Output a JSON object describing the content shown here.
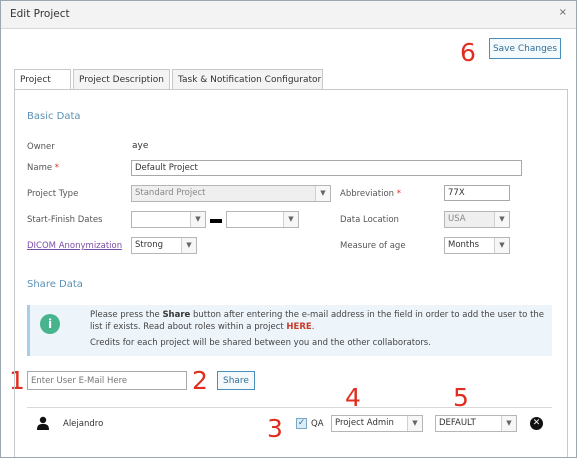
{
  "dialog": {
    "title": "Edit Project",
    "close_glyph": "×"
  },
  "toolbar": {
    "save_label": "Save Changes"
  },
  "tabs": [
    {
      "label": "Project",
      "active": true
    },
    {
      "label": "Project Description",
      "active": false
    },
    {
      "label": "Task & Notification Configurator",
      "active": false
    }
  ],
  "basic": {
    "section_title": "Basic Data",
    "owner_label": "Owner",
    "owner_value": "aye",
    "name_label": "Name",
    "required_mark": "*",
    "name_value": "Default Project",
    "project_type_label": "Project Type",
    "project_type_value": "Standard Project",
    "abbreviation_label": "Abbreviation",
    "abbreviation_value": "77X",
    "dates_label": "Start-Finish Dates",
    "start_date_value": "",
    "finish_date_value": "",
    "data_location_label": "Data Location",
    "data_location_value": "USA",
    "dicom_label": "DICOM Anonymization",
    "dicom_value": "Strong",
    "measure_label": "Measure of age",
    "measure_value": "Months"
  },
  "share": {
    "section_title": "Share Data",
    "info_line1_a": "Please press the ",
    "info_line1_b": "Share",
    "info_line1_c": " button after entering the e-mail address in the field in order to add the user to the",
    "info_line2_a": "list if exists. Read about roles within a project ",
    "info_line2_b": "HERE",
    "info_line2_c": ".",
    "info_line3": "Credits for each project will be shared between you and the other collaborators.",
    "email_placeholder": "Enter User E-Mail Here",
    "share_label": "Share",
    "user": {
      "name": "Alejandro",
      "qa_label": "QA",
      "qa_checked": true,
      "role_value": "Project Admin",
      "profile_value": "DEFAULT"
    }
  },
  "annotations": [
    "1",
    "2",
    "3",
    "4",
    "5",
    "6"
  ],
  "icons": {
    "info": "info-icon",
    "user": "user-icon",
    "remove": "remove-icon",
    "dropdown": "chevron-down-icon"
  },
  "colors": {
    "accent": "#5b91b5",
    "annotation": "#e12d1f",
    "info_icon": "#46b48c",
    "link": "#7b4ca5"
  }
}
